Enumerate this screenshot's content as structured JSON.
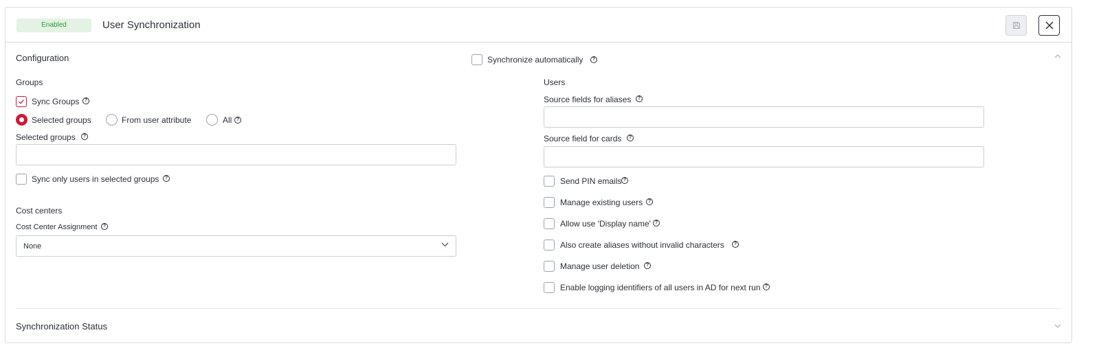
{
  "header": {
    "status_badge": "Enabled",
    "title": "User Synchronization",
    "save_icon": "save-icon",
    "close_icon": "close-icon"
  },
  "configuration": {
    "title": "Configuration",
    "sync_auto": {
      "label": "Synchronize automatically",
      "checked": false
    },
    "groups": {
      "title": "Groups",
      "sync_groups": {
        "label": "Sync Groups",
        "checked": true
      },
      "radios": [
        {
          "label": "Selected groups",
          "selected": true
        },
        {
          "label": "From user attribute",
          "selected": false
        },
        {
          "label": "All",
          "selected": false
        }
      ],
      "selected_groups_label": "Selected groups",
      "selected_groups_value": "",
      "sync_only_selected": {
        "label": "Sync only users in selected groups",
        "checked": false
      }
    },
    "cost_centers": {
      "title": "Cost centers",
      "assignment_label": "Cost Center Assignment",
      "assignment_value": "None"
    },
    "users": {
      "title": "Users",
      "aliases_label": "Source fields for aliases",
      "aliases_value": "",
      "cards_label": "Source field for cards",
      "cards_value": "",
      "options": [
        {
          "label": "Send PIN emails",
          "checked": false
        },
        {
          "label": "Manage existing users",
          "checked": false
        },
        {
          "label": "Allow use 'Display name'",
          "checked": false
        },
        {
          "label": "Also create aliases without invalid characters",
          "checked": false
        },
        {
          "label": "Manage user deletion",
          "checked": false
        },
        {
          "label": "Enable logging identifiers of all users in AD for next run",
          "checked": false
        }
      ]
    }
  },
  "sync_status": {
    "title": "Synchronization Status"
  },
  "colors": {
    "accent": "#d0173a",
    "badge_bg": "#e3f2e3",
    "badge_text": "#2e9b3c",
    "border": "#d9dce1"
  }
}
